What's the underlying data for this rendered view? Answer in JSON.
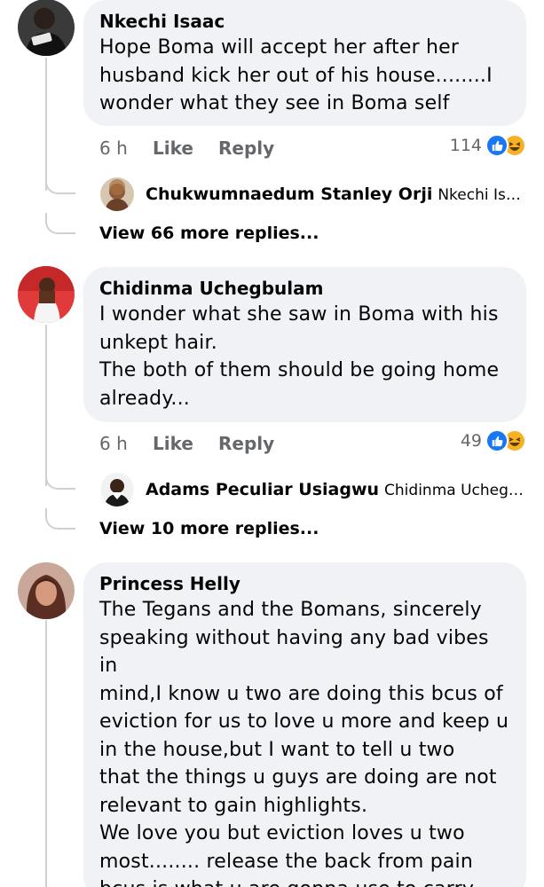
{
  "comments": [
    {
      "author": "Nkechi Isaac",
      "text_lines": [
        "Hope Boma will accept her after her",
        "husband kick her out of his house........I",
        "wonder what they see in Boma self"
      ],
      "time": "6 h",
      "like_label": "Like",
      "reply_label": "Reply",
      "reaction_count": "114",
      "reply_preview": {
        "name": "Chukwumnaedum Stanley Orji",
        "text": "Nkechi Isaac..."
      },
      "view_more": "View 66 more replies..."
    },
    {
      "author": "Chidinma Uchegbulam",
      "text_lines": [
        "I wonder what she saw in Boma with his",
        "unkept hair.",
        "The both of them should be going home",
        "already..."
      ],
      "time": "6 h",
      "like_label": "Like",
      "reply_label": "Reply",
      "reaction_count": "49",
      "reply_preview": {
        "name": "Adams Peculiar Usiagwu",
        "text": "Chidinma Uchegbula..."
      },
      "view_more": "View 10 more replies..."
    },
    {
      "author": "Princess Helly",
      "text_lines": [
        "The Tegans and the Bomans, sincerely",
        "speaking without having any bad vibes in",
        "mind,I know u two are doing this bcus of",
        "eviction for us to love u more and keep u",
        "in the house,but I want to tell u two",
        "that the things u guys are doing are not",
        "relevant to gain highlights.",
        "We love you but eviction loves u two",
        "most........ release the back from pain",
        "bcus is what u are gonna use to carry"
      ]
    }
  ],
  "colors": {
    "bubble": "#f0f2f5",
    "like_blue": "#1877f2",
    "haha_yellow": "#f7b125",
    "meta_gray": "#65676b"
  }
}
